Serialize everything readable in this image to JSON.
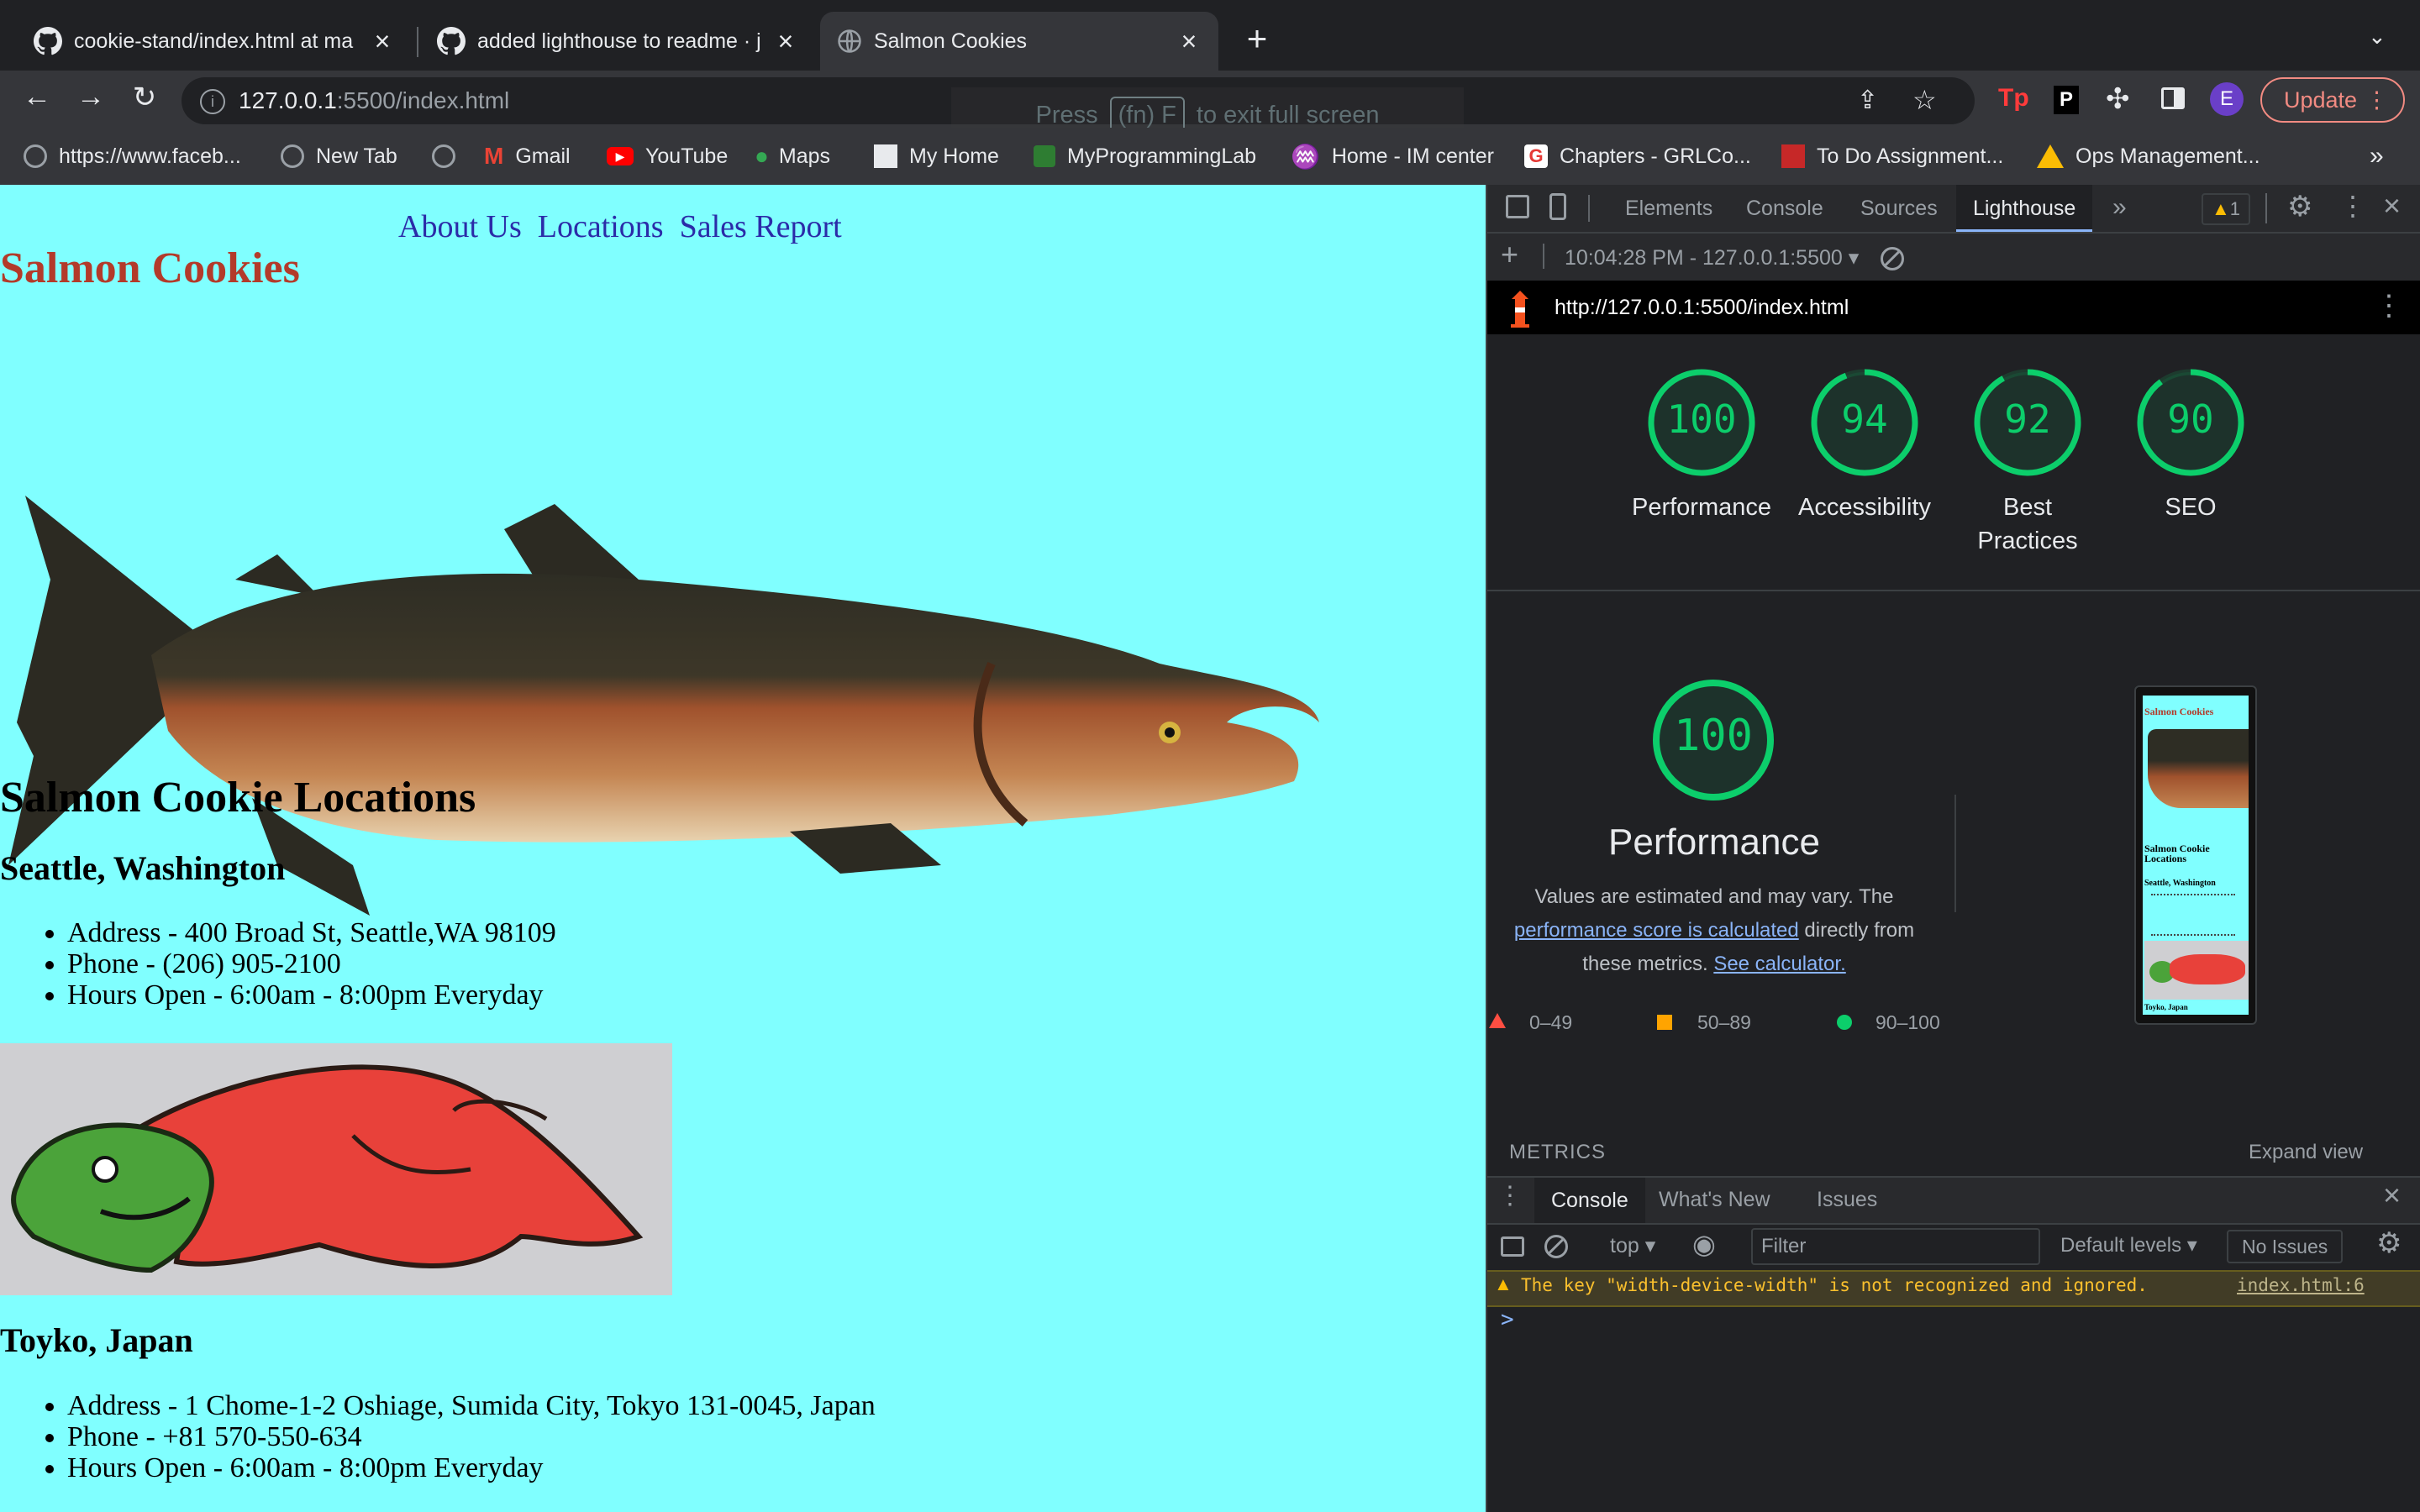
{
  "browser": {
    "tabs": [
      {
        "title": "cookie-stand/index.html at ma",
        "icon": "github-icon"
      },
      {
        "title": "added lighthouse to readme · j",
        "icon": "github-icon"
      },
      {
        "title": "Salmon Cookies",
        "icon": "globe-icon",
        "active": true
      }
    ],
    "new_tab_symbol": "+",
    "url_host": "127.0.0.1",
    "url_rest": ":5500/index.html",
    "fullscreen_hint": {
      "press": "Press",
      "key": "(fn) F",
      "rest": "to exit full screen"
    },
    "profile_initial": "E",
    "update_label": "Update",
    "bookmarks": [
      {
        "label": "https://www.faceb...",
        "color": "#9aa0a6"
      },
      {
        "label": "New Tab",
        "color": "#9aa0a6"
      },
      {
        "label": "",
        "color": "#9aa0a6"
      },
      {
        "label": "Gmail",
        "color": "#ea4335"
      },
      {
        "label": "YouTube",
        "color": "#ff0000"
      },
      {
        "label": "Maps",
        "color": "#34a853"
      },
      {
        "label": "My Home",
        "color": "#4285f4"
      },
      {
        "label": "MyProgrammingLab",
        "color": "#2e7d32"
      },
      {
        "label": "Home - IM center",
        "color": "#80cbc4"
      },
      {
        "label": "Chapters - GRLCo...",
        "color": "#e53935"
      },
      {
        "label": "To Do Assignment...",
        "color": "#c62828"
      },
      {
        "label": "Ops Management...",
        "color": "#fbbc04"
      }
    ],
    "bookmarks_overflow": "»"
  },
  "page": {
    "nav": [
      "About Us",
      "Locations",
      "Sales Report"
    ],
    "brand": "Salmon Cookies",
    "locations_heading": "Salmon Cookie Locations",
    "locations": [
      {
        "city": "Seattle, Washington",
        "details": [
          "Address - 400 Broad St, Seattle,WA 98109",
          "Phone - (206) 905-2100",
          "Hours Open - 6:00am - 8:00pm Everyday"
        ]
      },
      {
        "city": "Toyko, Japan",
        "details": [
          "Address - 1 Chome-1-2 Oshiage, Sumida City, Tokyo 131-0045, Japan",
          "Phone - +81 570-550-634",
          "Hours Open - 6:00am - 8:00pm Everyday"
        ]
      }
    ]
  },
  "devtools": {
    "tabs": [
      "Elements",
      "Console",
      "Sources",
      "Lighthouse"
    ],
    "active_tab": "Lighthouse",
    "warning_count": "1",
    "report_selector": "10:04:28 PM - 127.0.0.1:5500",
    "report_url": "http://127.0.0.1:5500/index.html",
    "scores": [
      {
        "value": 100,
        "label": "Performance"
      },
      {
        "value": 94,
        "label": "Accessibility"
      },
      {
        "value": 92,
        "label": "Best Practices"
      },
      {
        "value": 90,
        "label": "SEO"
      }
    ],
    "performance": {
      "score": 100,
      "title": "Performance",
      "desc_prefix": "Values are estimated and may vary. The",
      "link1": "performance score is calculated",
      "desc_mid": "directly from these metrics.",
      "link2": "See calculator.",
      "legend": [
        "0–49",
        "50–89",
        "90–100"
      ],
      "legend_colors": [
        "#ff4e42",
        "#ffa400",
        "#0cce6b"
      ]
    },
    "thumb": {
      "brand": "Salmon Cookie Locations",
      "title": "Salmon Cookies",
      "city": "Seattle, Washington",
      "footer": "Toyko, Japan"
    },
    "metrics_label": "METRICS",
    "expand_view": "Expand view",
    "drawer_tabs": [
      "Console",
      "What's New",
      "Issues"
    ],
    "console_context": "top",
    "filter_placeholder": "Filter",
    "levels": "Default levels",
    "issues": "No Issues",
    "warning_message": "The key \"width-device-width\" is not recognized and ignored.",
    "warning_source": "index.html:6",
    "prompt": ">"
  }
}
